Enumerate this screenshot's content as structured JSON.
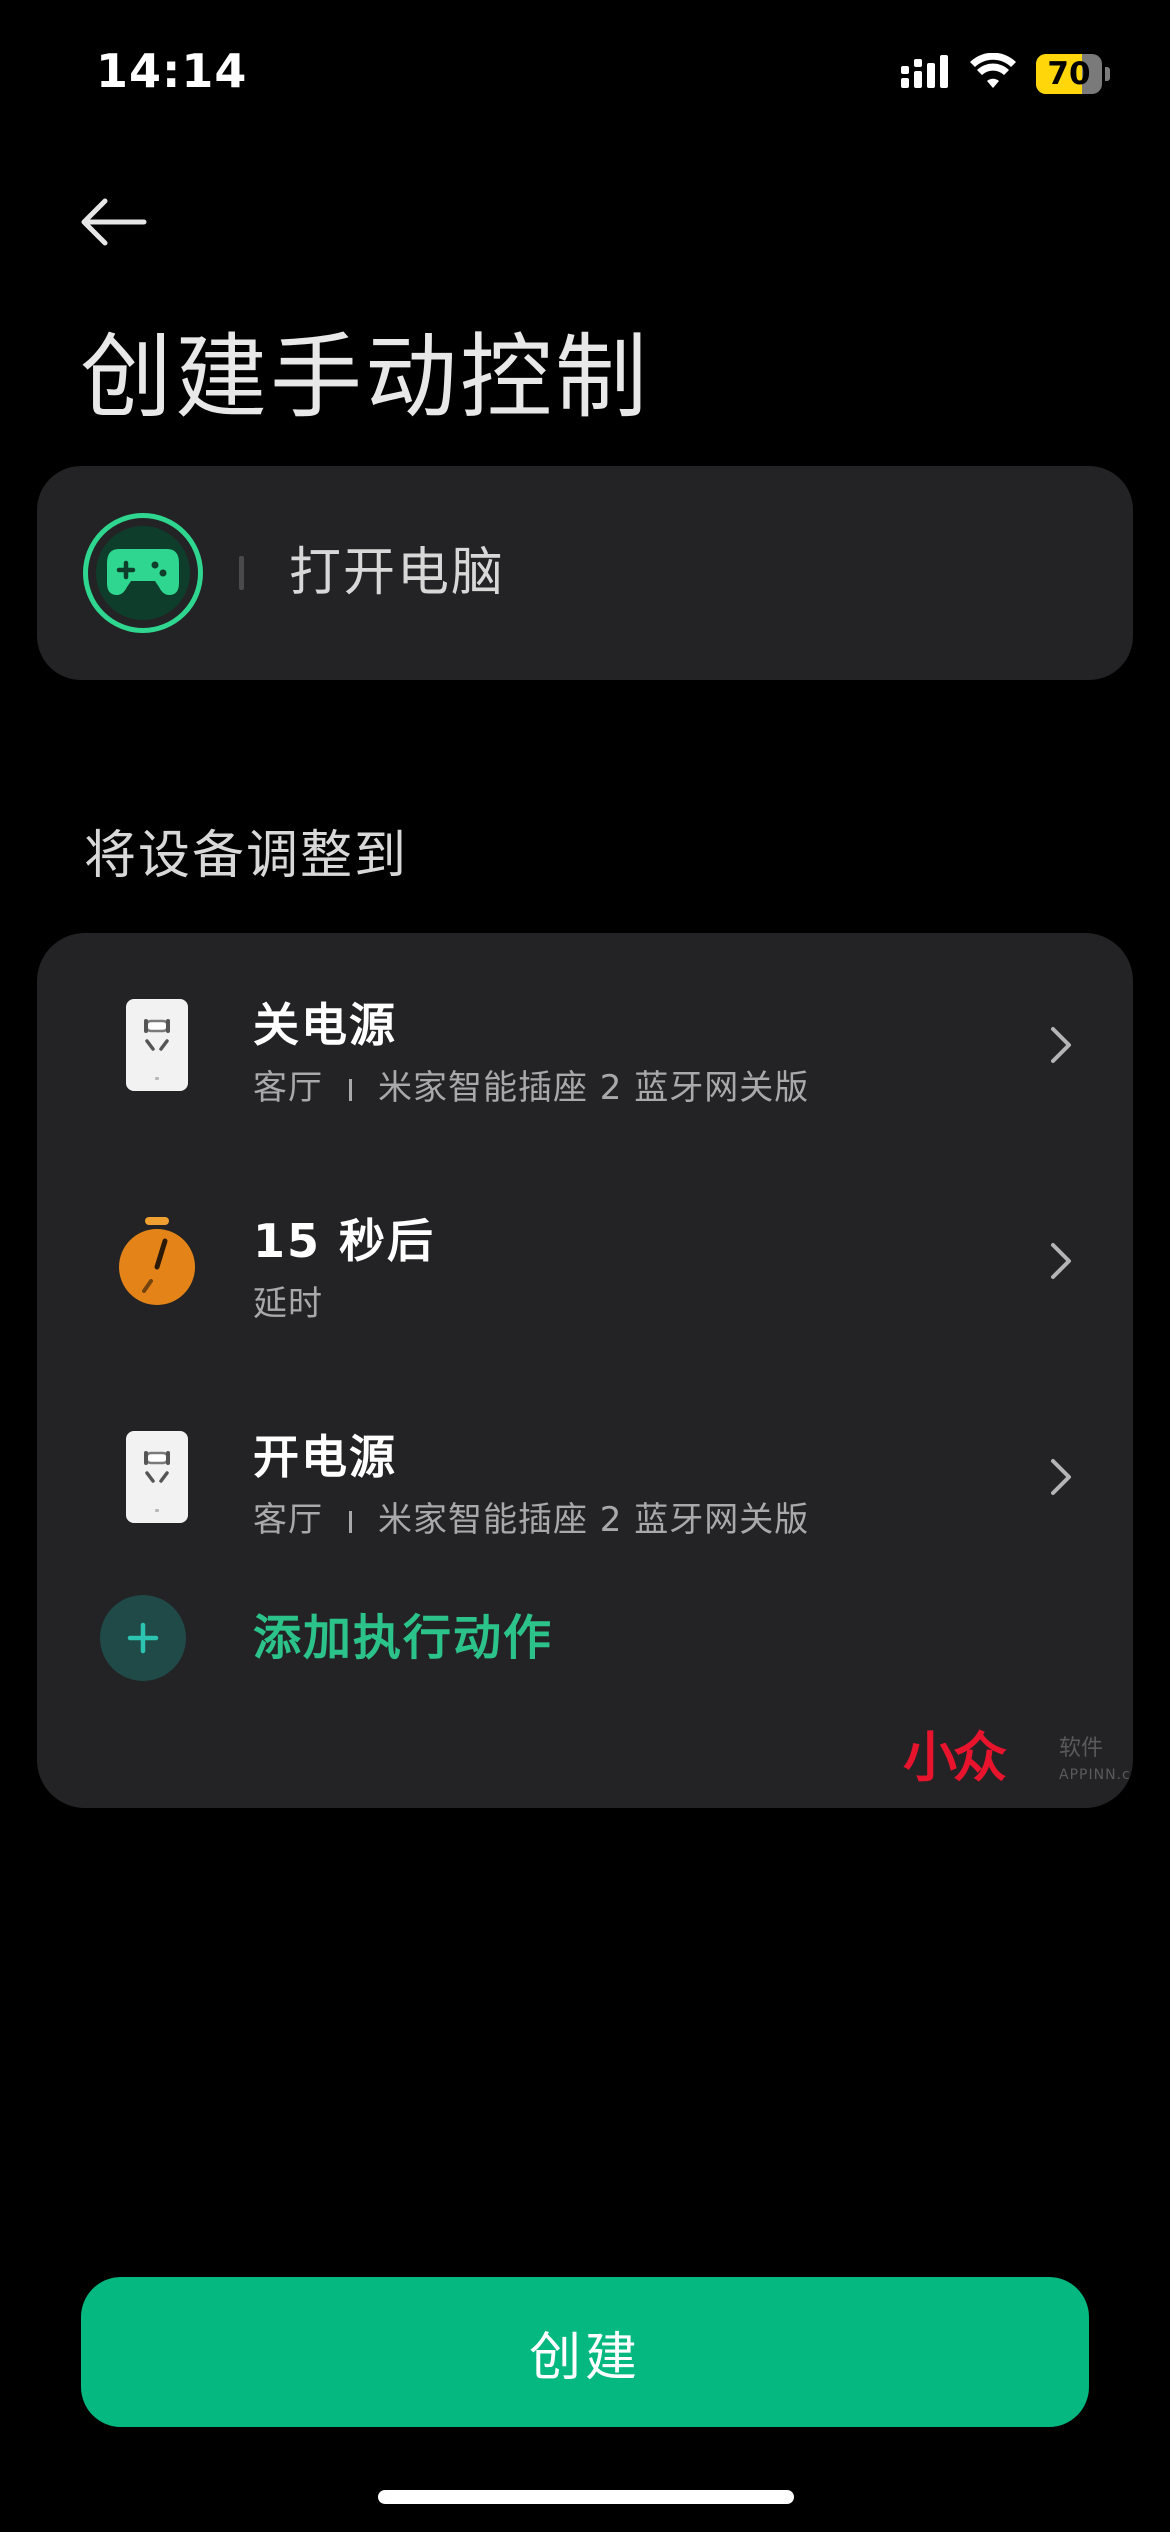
{
  "status_bar": {
    "time": "14:14",
    "battery_level": "70",
    "battery_fraction": 0.7,
    "battery_color": "#ffd60a"
  },
  "header": {
    "back_icon": "arrow-left-icon",
    "title": "创建手动控制"
  },
  "scene": {
    "icon": "gamepad-icon",
    "name": "打开电脑",
    "accent_color": "#2fd68f"
  },
  "actions_section": {
    "title": "将设备调整到",
    "items": [
      {
        "icon": "smart-plug-icon",
        "title": "关电源",
        "room": "客厅",
        "device": "米家智能插座 2 蓝牙网关版"
      },
      {
        "icon": "timer-icon",
        "title": "15 秒后",
        "subtitle": "延时"
      },
      {
        "icon": "smart-plug-icon",
        "title": "开电源",
        "room": "客厅",
        "device": "米家智能插座 2 蓝牙网关版"
      }
    ],
    "add_label": "添加执行动作",
    "add_color": "#2cc38a"
  },
  "watermark": {
    "logo_text": "小众",
    "small_text": "软件",
    "url": "APPINN.com"
  },
  "footer": {
    "create_label": "创建",
    "create_color": "#04b880"
  }
}
